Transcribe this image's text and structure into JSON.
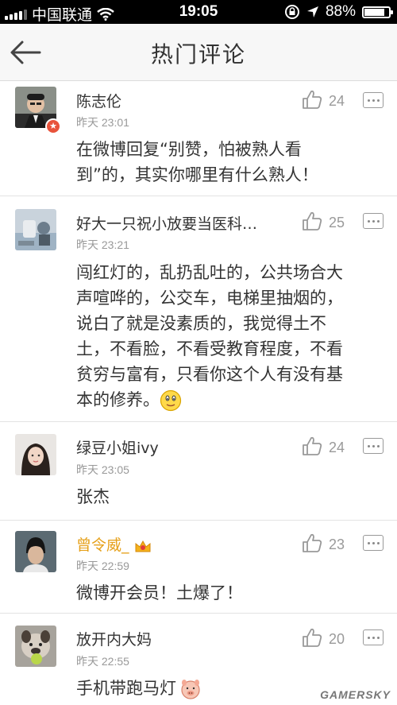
{
  "status_bar": {
    "carrier": "中国联通",
    "time": "19:05",
    "battery": "88%",
    "battery_level": 0.88
  },
  "header": {
    "title": "热门评论"
  },
  "comments": [
    {
      "name": "陈志伦",
      "time": "昨天 23:01",
      "likes": "24",
      "text": "在微博回复“别赞，怕被熟人看到”的，其实你哪里有什么熟人！"
    },
    {
      "name": "好大一只祝小放要当医科…",
      "time": "昨天 23:21",
      "likes": "25",
      "text": "闯红灯的，乱扔乱吐的，公共场合大声喧哗的，公交车，电梯里抽烟的，说白了就是没素质的，我觉得土不土，不看脸，不看受教育程度，不看贫穷与富有，只看你这个人有没有基本的修养。"
    },
    {
      "name": "绿豆小姐ivy",
      "time": "昨天 23:05",
      "likes": "24",
      "text": "张杰"
    },
    {
      "name": "曾令威_",
      "time": "昨天 22:59",
      "likes": "23",
      "text": "微博开会员！土爆了！"
    },
    {
      "name": "放开内大妈",
      "time": "昨天 22:55",
      "likes": "20",
      "text": "手机带跑马灯"
    }
  ],
  "watermark": "GAMERSKY"
}
